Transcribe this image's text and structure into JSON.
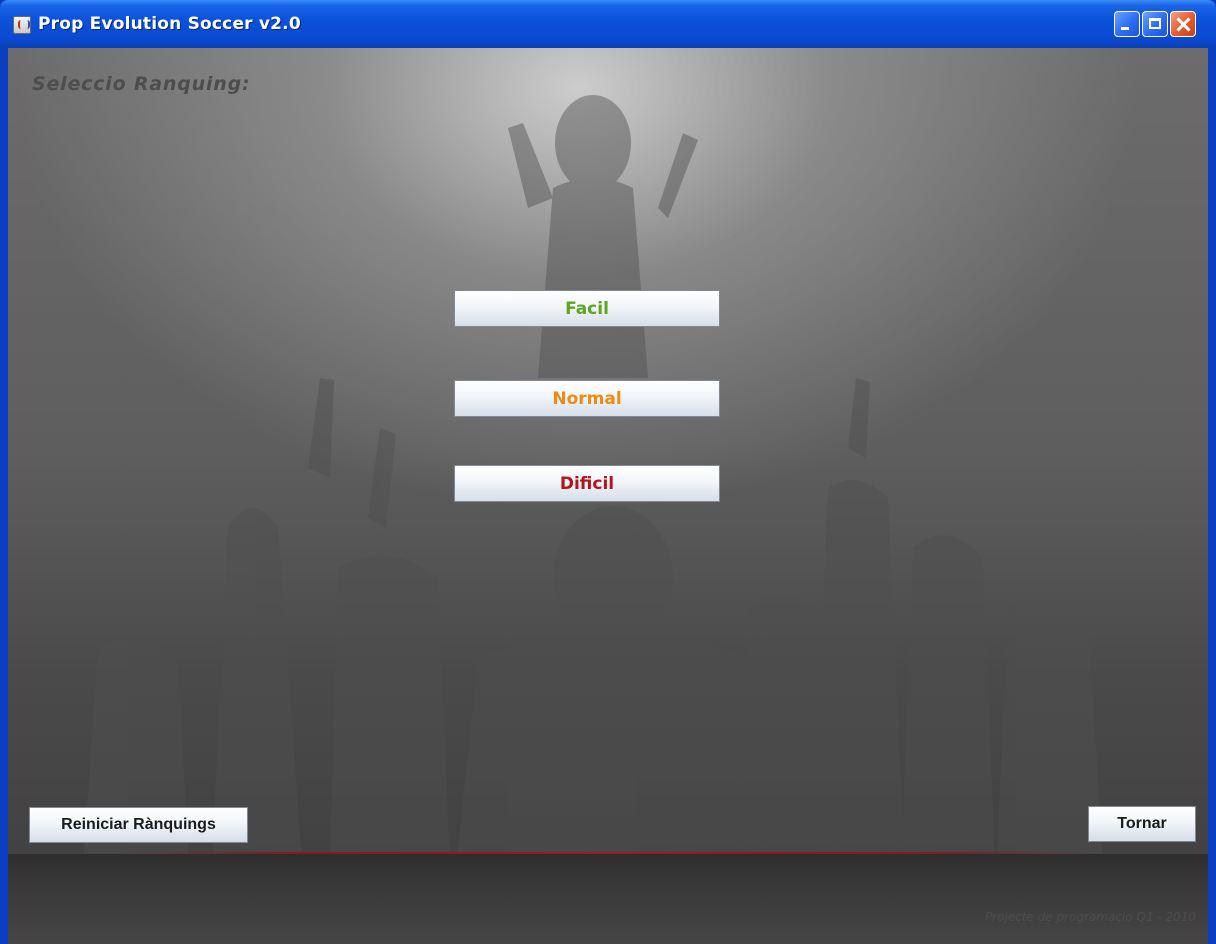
{
  "window": {
    "title": "Prop Evolution Soccer v2.0",
    "icon": "java-cup-icon",
    "controls": [
      "minimize-icon",
      "maximize-icon",
      "close-icon"
    ]
  },
  "screen": {
    "heading": "Seleccio Ranquing:"
  },
  "difficulty_buttons": [
    {
      "label": "Facil",
      "color": "#5aa61e"
    },
    {
      "label": "Normal",
      "color": "#ef8a14"
    },
    {
      "label": "Dificil",
      "color": "#b4141e"
    }
  ],
  "actions": {
    "reset_label": "Reiniciar Rànquings",
    "back_label": "Tornar"
  },
  "footer": {
    "credit": "Projecte de programacio Q1 - 2010"
  },
  "colors": {
    "titlebar": "#0b52dc",
    "accent_line": "#9a1b27"
  }
}
